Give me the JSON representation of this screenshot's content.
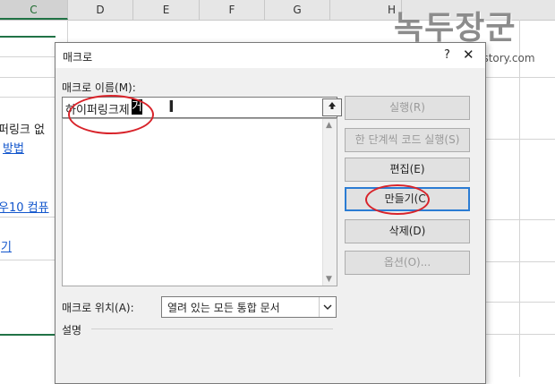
{
  "sheet": {
    "columns": [
      "C",
      "D",
      "E",
      "F",
      "G",
      "H"
    ],
    "selected_column": "C",
    "cells": [
      {
        "text": "퍼링크 없",
        "link": false
      },
      {
        "text": "방법",
        "link": true
      },
      {
        "text": "우10 컴퓨",
        "link": true
      },
      {
        "text": "기",
        "link": true
      }
    ]
  },
  "watermark": {
    "title": "녹두장군",
    "url": "http://maxia.tistory.com"
  },
  "dialog": {
    "title": "매크로",
    "help_icon": "question-icon",
    "close_icon": "close-icon",
    "name_label": "매크로 이름(M):",
    "name_value": "하이퍼링크제거",
    "name_typed": "하이퍼링크제",
    "name_cursor_char": "거",
    "up_arrow_icon": "upload-arrow-icon",
    "buttons": {
      "run": "실행(R)",
      "step": "한 단계씩 코드 실행(S)",
      "edit": "편집(E)",
      "create": "만들기(C)",
      "delete": "삭제(D)",
      "options": "옵션(O)..."
    },
    "location_label": "매크로 위치(A):",
    "location_value": "열려 있는 모든 통합 문서",
    "description_label": "설명"
  },
  "colors": {
    "accent": "#2b7cd3",
    "annotation": "#d8232a",
    "excel_green": "#217346",
    "link": "#1155cc"
  }
}
